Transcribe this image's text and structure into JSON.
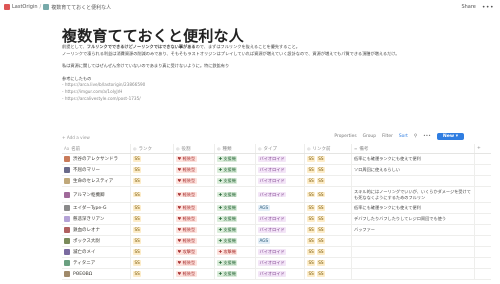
{
  "topbar": {
    "workspace": "LastOrigin",
    "page": "複数育てておくと便利な人",
    "share": "Share",
    "more": "•••"
  },
  "page": {
    "title": "複数育てておくと便利な人",
    "p1_pre": "前提として、",
    "p1_bold": "フルリンクでできるけどノーリンクではできない事がある",
    "p1_post": "ので、まずはフルリンクを抜えることを優先すること。",
    "p2": "ノーリンクで凍られる利益は消費資源の削減のみであり、そもそもラストオリジンはプレイしていれば資源が増えていく設計なので、資源が増えてもパ質できる頂膳が増えるだけ。",
    "p3": "私は資源に関してはぜんぜん余けていないのであまり真に受けないように。特に鉄鉱有り",
    "ref_label": "参考にしたもの",
    "links": [
      "- https://arca.live/b/lastorigin/23866590",
      "- https://imgur.com/a/1oIyJrH",
      "- https://arcalivestyle.com/post-1735/"
    ]
  },
  "db": {
    "add_view": "+ Add a view",
    "tools": [
      "Properties",
      "Group",
      "Filter",
      "Sort"
    ],
    "search_icon": "search-icon",
    "new_label": "New",
    "columns": [
      "名前",
      "ランク",
      "役割",
      "種類",
      "タイプ",
      "リンク前",
      "備考"
    ],
    "rows": [
      {
        "name": "渋谷のアレクサンドラ",
        "rank": "SS",
        "role": "軽装型",
        "kind": "支援機",
        "type": "バイオロイド",
        "link": "SS",
        "link2": "SS",
        "note": "低率にも確運ランクにも使えて便利",
        "color": "#c97b5a"
      },
      {
        "name": "不屈のマリー",
        "rank": "SS",
        "role": "軽装型",
        "kind": "支援機",
        "type": "バイオロイド",
        "link": "SS",
        "link2": "SS",
        "note": "ソロ周回に使えるらしい",
        "color": "#6a6a8a"
      },
      {
        "name": "生命のセレスティア",
        "rank": "SS",
        "role": "軽装型",
        "kind": "支援機",
        "type": "バイオロイド",
        "link": "SS",
        "link2": "SS",
        "note": "",
        "color": "#c0a87a"
      },
      {
        "name": "アルマン枢機卿",
        "rank": "SS",
        "role": "軽装型",
        "kind": "支援機",
        "type": "バイオロイド",
        "link": "SS",
        "link2": "SS",
        "note": "スキル的にはノーリングでいいが、いくらかダメージを受けても死ななくようにするためのフルリン",
        "color": "#a06a9a",
        "tall": true
      },
      {
        "name": "エイダーType-G",
        "rank": "SS",
        "role": "軽装型",
        "kind": "支援機",
        "type": "AGS",
        "link": "SS",
        "link2": "SS",
        "note": "低率にも確運ランクにも使えて便利",
        "color": "#8a8a8a"
      },
      {
        "name": "慈悲深きリアン",
        "rank": "SS",
        "role": "軽装型",
        "kind": "支援機",
        "type": "バイオロイド",
        "link": "SS",
        "link2": "SS",
        "note": "デバフしたりバフしたりしてレジロ周回でも使う",
        "color": "#b4a2d6"
      },
      {
        "name": "鉄血のレオナ",
        "rank": "SS",
        "role": "軽装型",
        "kind": "支援機",
        "type": "バイオロイド",
        "link": "SS",
        "link2": "SS",
        "note": "バッファー",
        "color": "#b06060"
      },
      {
        "name": "ポックス大尉",
        "rank": "SS",
        "role": "軽装型",
        "kind": "支援機",
        "type": "AGS",
        "link": "SS",
        "link2": "SS",
        "note": "",
        "color": "#7a8a5a"
      },
      {
        "name": "滅亡のメイ",
        "rank": "SS",
        "role": "攻撃型",
        "kind": "攻撃機",
        "type": "バイオロイド",
        "link": "SS",
        "link2": "SS",
        "note": "",
        "color": "#7a6aa0"
      },
      {
        "name": "ティタニア",
        "rank": "SS",
        "role": "軽装型",
        "kind": "支援機",
        "type": "バイオロイド",
        "link": "SS",
        "link2": "SS",
        "note": "",
        "color": "#6aa080"
      },
      {
        "name": "ΡΘΕΘΒΩ",
        "rank": "SS",
        "role": "軽装型",
        "kind": "支援機",
        "type": "バイオロイド",
        "link": "SS",
        "link2": "SS",
        "note": "",
        "color": "#a08a6a"
      }
    ]
  }
}
